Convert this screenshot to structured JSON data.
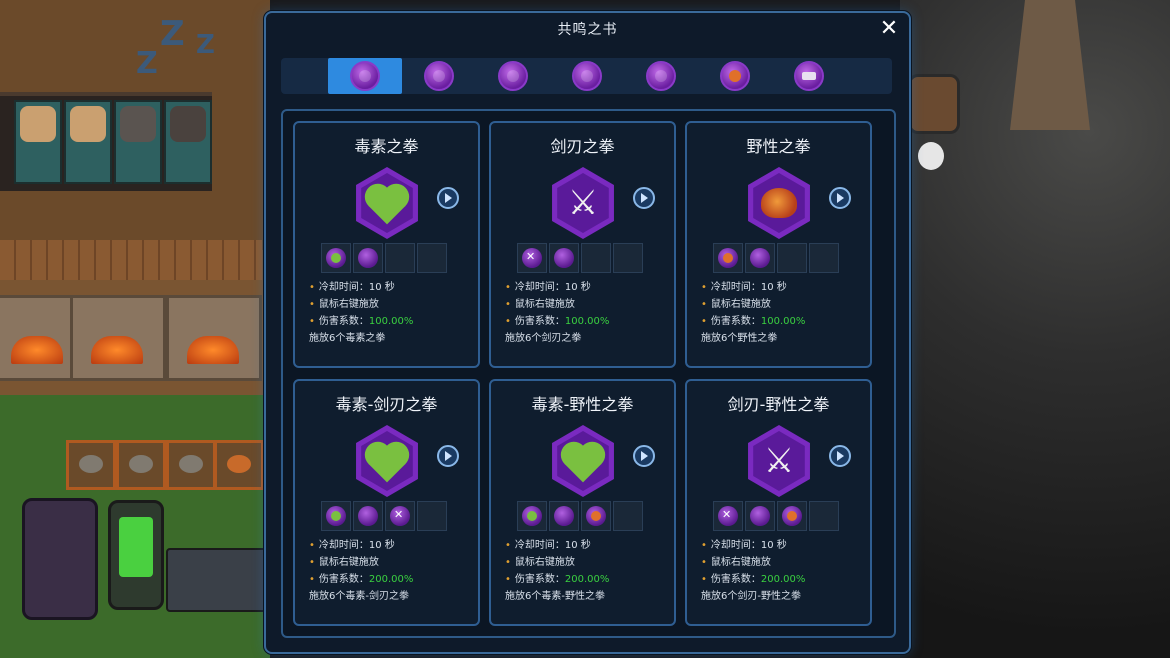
{
  "panel": {
    "title": "共鸣之书"
  },
  "tabs": [
    {
      "icon": "purple-orb-icon",
      "active": true
    },
    {
      "icon": "purple-orb-icon",
      "active": false
    },
    {
      "icon": "purple-orb-icon",
      "active": false
    },
    {
      "icon": "purple-orb-icon",
      "active": false
    },
    {
      "icon": "purple-orb-icon",
      "active": false
    },
    {
      "icon": "orange-fist-icon",
      "active": false
    },
    {
      "icon": "white-claw-icon",
      "active": false
    }
  ],
  "cards": [
    {
      "title": "毒素之拳",
      "emblem": "green-heart",
      "cooldown": "冷却时间：10 秒",
      "action": "鼠标右键施放",
      "damage_label": "伤害系数：",
      "damage_value": "100.00%",
      "cast": "施放6个毒素之拳"
    },
    {
      "title": "剑刃之拳",
      "emblem": "crossed-swords",
      "cooldown": "冷却时间：10 秒",
      "action": "鼠标右键施放",
      "damage_label": "伤害系数：",
      "damage_value": "100.00%",
      "cast": "施放6个剑刃之拳"
    },
    {
      "title": "野性之拳",
      "emblem": "wild-boar",
      "cooldown": "冷却时间：10 秒",
      "action": "鼠标右键施放",
      "damage_label": "伤害系数：",
      "damage_value": "100.00%",
      "cast": "施放6个野性之拳"
    },
    {
      "title": "毒素-剑刃之拳",
      "emblem": "green-heart",
      "cooldown": "冷却时间：10 秒",
      "action": "鼠标右键施放",
      "damage_label": "伤害系数：",
      "damage_value": "200.00%",
      "cast": "施放6个毒素-剑刃之拳"
    },
    {
      "title": "毒素-野性之拳",
      "emblem": "green-heart",
      "cooldown": "冷却时间：10 秒",
      "action": "鼠标右键施放",
      "damage_label": "伤害系数：",
      "damage_value": "200.00%",
      "cast": "施放6个毒素-野性之拳"
    },
    {
      "title": "剑刃-野性之拳",
      "emblem": "crossed-swords",
      "cooldown": "冷却时间：10 秒",
      "action": "鼠标右键施放",
      "damage_label": "伤害系数：",
      "damage_value": "200.00%",
      "cast": "施放6个剑刃-野性之拳"
    }
  ],
  "colors": {
    "accent": "#2e8ae0",
    "damage_value": "#3ad040",
    "bullet": "#e0a030"
  }
}
